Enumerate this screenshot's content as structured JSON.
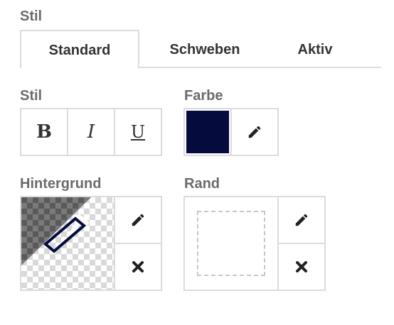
{
  "section_title": "Stil",
  "tabs": [
    {
      "label": "Standard",
      "active": true
    },
    {
      "label": "Schweben",
      "active": false
    },
    {
      "label": "Aktiv",
      "active": false
    }
  ],
  "style_group": {
    "label": "Stil",
    "buttons": [
      {
        "label": "B",
        "name": "bold"
      },
      {
        "label": "I",
        "name": "italic"
      },
      {
        "label": "U",
        "name": "underline"
      }
    ]
  },
  "color_group": {
    "label": "Farbe",
    "swatch_color": "#050b3d",
    "edit_icon": "pencil-icon"
  },
  "background_group": {
    "label": "Hintergrund",
    "edit_icon": "pencil-icon",
    "clear_icon": "close-icon"
  },
  "border_group": {
    "label": "Rand",
    "edit_icon": "pencil-icon",
    "clear_icon": "close-icon"
  }
}
